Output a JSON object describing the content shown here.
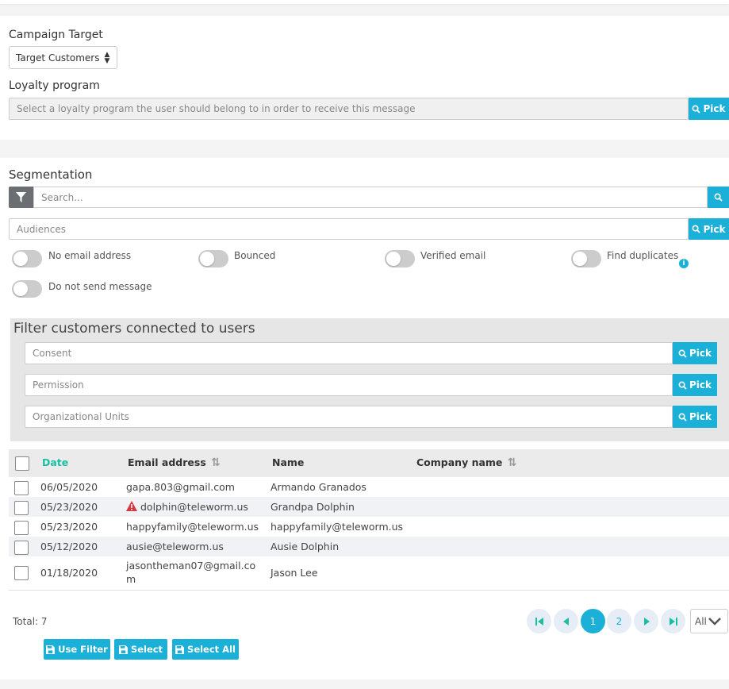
{
  "campaign": {
    "target_label": "Campaign Target",
    "target_value": "Target Customers",
    "loyalty_label": "Loyalty program",
    "loyalty_placeholder": "Select a loyalty program the user should belong to in order to receive this message",
    "pick_label": "Pick"
  },
  "segmentation": {
    "title": "Segmentation",
    "search_placeholder": "Search...",
    "audiences_placeholder": "Audiences",
    "pick_label": "Pick",
    "toggles": [
      "No email address",
      "Bounced",
      "Verified email",
      "Find duplicates",
      "Do not send message"
    ]
  },
  "filter_panel": {
    "title": "Filter customers connected to users",
    "consent": "Consent",
    "permission": "Permission",
    "org_units": "Organizational Units",
    "pick_label": "Pick"
  },
  "table": {
    "headers": [
      "Date",
      "Email address",
      "Name",
      "Company name"
    ],
    "rows": [
      {
        "date": "06/05/2020",
        "email": "gapa.803@gmail.com",
        "name": "Armando Granados",
        "warning": false
      },
      {
        "date": "05/23/2020",
        "email": "dolphin@teleworm.us",
        "name": "Grandpa Dolphin",
        "warning": true
      },
      {
        "date": "05/23/2020",
        "email": "happyfamily@teleworm.us",
        "name": "happyfamily@teleworm.us",
        "warning": false
      },
      {
        "date": "05/12/2020",
        "email": "ausie@teleworm.us",
        "name": "Ausie Dolphin",
        "warning": false
      },
      {
        "date": "01/18/2020",
        "email_line1": "jasontheman07@gmail.co",
        "email_line2": "m",
        "name": "Jason Lee",
        "warning": false
      }
    ]
  },
  "footer": {
    "total": "Total: 7",
    "pages": [
      "1",
      "2"
    ],
    "page_size": "All",
    "use_filter": "Use Filter",
    "select": "Select",
    "select_all": "Select All"
  },
  "colors": {
    "accent": "#1ab0d8",
    "sort_active": "#19c0a0",
    "warning": "#d9363e"
  }
}
